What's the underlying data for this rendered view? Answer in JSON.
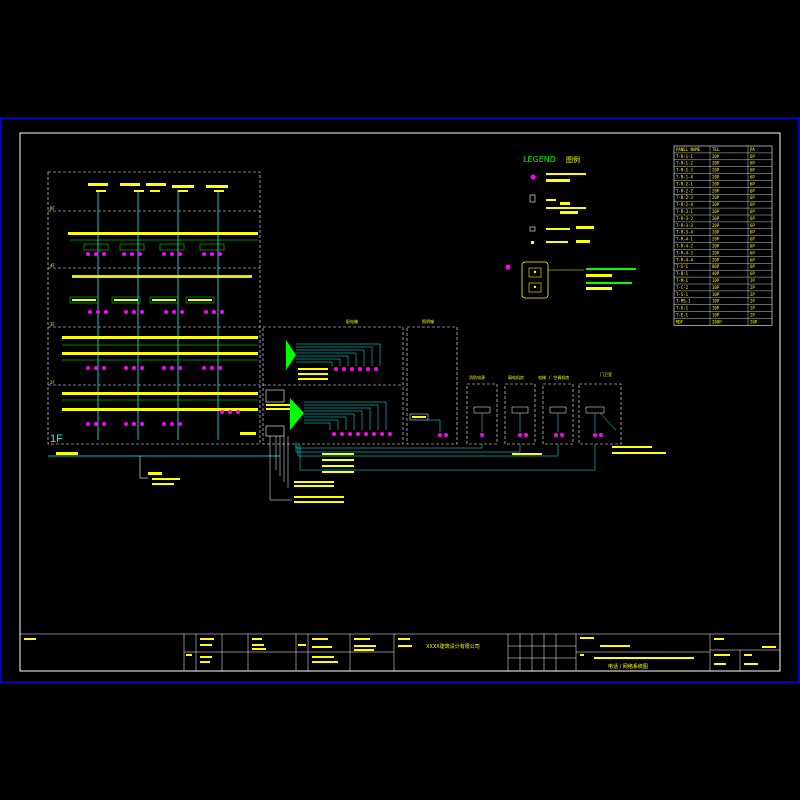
{
  "colors": {
    "frame": "#0000ff",
    "border": "#ffffff",
    "feeder": "#00ffff",
    "busbar": "#00ff00",
    "panel": "#ffffff",
    "text": "#ffff00",
    "outlet": "#ff00ff"
  },
  "floors": {
    "roof_label": "RF",
    "floor4_label": "4F",
    "floor3_label": "3F",
    "floor2_label": "2F",
    "floor1_label": "1F"
  },
  "boxes": {
    "main_box_label": "配电箱",
    "box2_label": "照明箱",
    "sub1_label": "消防电源",
    "sub2_label": "弱电机房",
    "sub3_label": "电梯 / 空调机房",
    "sub4_label": "门卫室"
  },
  "legend": {
    "title": "LEGEND",
    "title_cn": "图例"
  },
  "schedule": {
    "headers": [
      "PANEL NAME",
      "TEL",
      "PA"
    ],
    "rows": [
      [
        "T-R-1-1",
        "20P",
        "6P"
      ],
      [
        "T-R-1-2",
        "20P",
        "6P"
      ],
      [
        "T-R-1-3",
        "20P",
        "6P"
      ],
      [
        "T-R-1-4",
        "20P",
        "6P"
      ],
      [
        "T-R-2-1",
        "20P",
        "6P"
      ],
      [
        "T-R-2-2",
        "20P",
        "6P"
      ],
      [
        "T-R-2-3",
        "20P",
        "6P"
      ],
      [
        "T-R-2-4",
        "20P",
        "6P"
      ],
      [
        "T-R-3-1",
        "20P",
        "6P"
      ],
      [
        "T-R-3-2",
        "20P",
        "6P"
      ],
      [
        "T-R-3-3",
        "20P",
        "6P"
      ],
      [
        "T-R-3-4",
        "20P",
        "6P"
      ],
      [
        "T-R-4-1",
        "20P",
        "6P"
      ],
      [
        "T-R-4-2",
        "20P",
        "6P"
      ],
      [
        "T-R-4-3",
        "20P",
        "6P"
      ],
      [
        "T-R-4-4",
        "20P",
        "6P"
      ],
      [
        "T-G-1",
        "80P",
        "6P"
      ],
      [
        "T-B-1",
        "40P",
        "6P"
      ],
      [
        "T-M-1",
        "10P",
        "2P"
      ],
      [
        "T-C-2",
        "10P",
        "2P"
      ],
      [
        "T-S-1",
        "10P",
        "2P"
      ],
      [
        "T-MS-1",
        "10P",
        "2P"
      ],
      [
        "T-U-1",
        "10P",
        "2P"
      ],
      [
        "T-E-1",
        "10P",
        "2P"
      ],
      [
        "MDF",
        "200P",
        "20P"
      ]
    ]
  },
  "title_block": {
    "company": "XXXX建筑设计有限公司",
    "drawing_title": "电话 / 网络系统图"
  }
}
